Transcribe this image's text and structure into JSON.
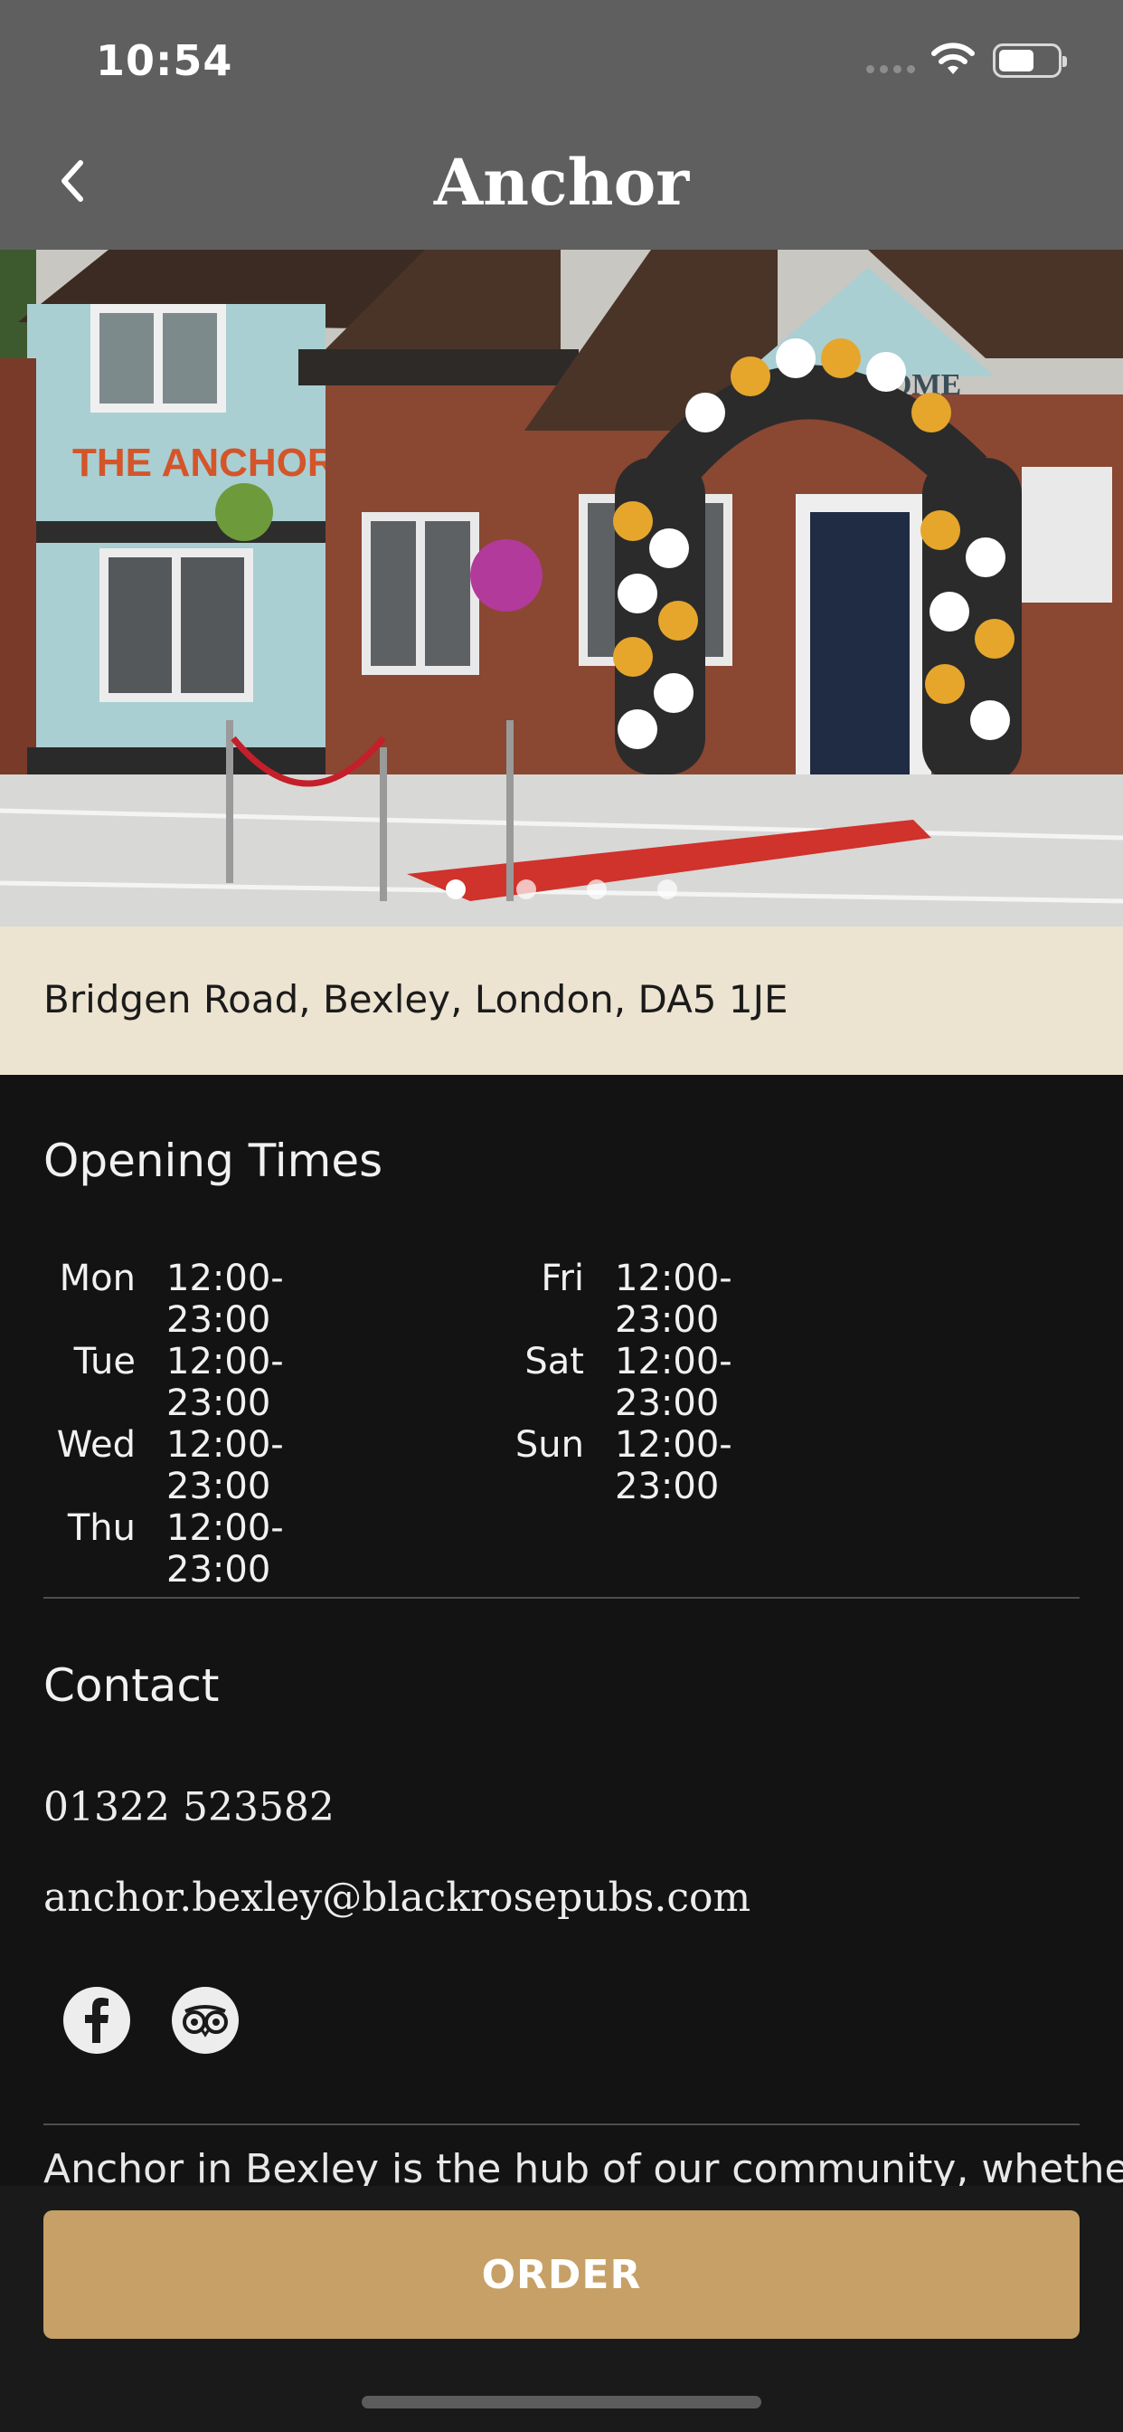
{
  "status_bar": {
    "time": "10:54"
  },
  "nav": {
    "title": "Anchor"
  },
  "hero": {
    "sign_text": "THE ANCHOR",
    "welcome_text": "WELCOME",
    "slide_count": 4,
    "active_slide": 1
  },
  "address": "Bridgen Road, Bexley, London, DA5 1JE",
  "opening_times": {
    "title": "Opening Times",
    "days": [
      {
        "day": "Mon",
        "time": "12:00-23:00"
      },
      {
        "day": "Tue",
        "time": "12:00-23:00"
      },
      {
        "day": "Wed",
        "time": "12:00-23:00"
      },
      {
        "day": "Thu",
        "time": "12:00-23:00"
      },
      {
        "day": "Fri",
        "time": "12:00-23:00"
      },
      {
        "day": "Sat",
        "time": "12:00-23:00"
      },
      {
        "day": "Sun",
        "time": "12:00-23:00"
      }
    ]
  },
  "contact": {
    "title": "Contact",
    "phone": "01322 523582",
    "email": "anchor.bexley@blackrosepubs.com",
    "socials": [
      "facebook-icon",
      "tripadvisor-icon"
    ]
  },
  "about": {
    "text": "Anchor in Bexley is the hub of our community, whether"
  },
  "cta": {
    "order_label": "ORDER"
  },
  "colors": {
    "nav_background": "#5f5f5f",
    "address_background": "#ece3d1",
    "page_background": "#131313",
    "accent": "#c6a066"
  }
}
